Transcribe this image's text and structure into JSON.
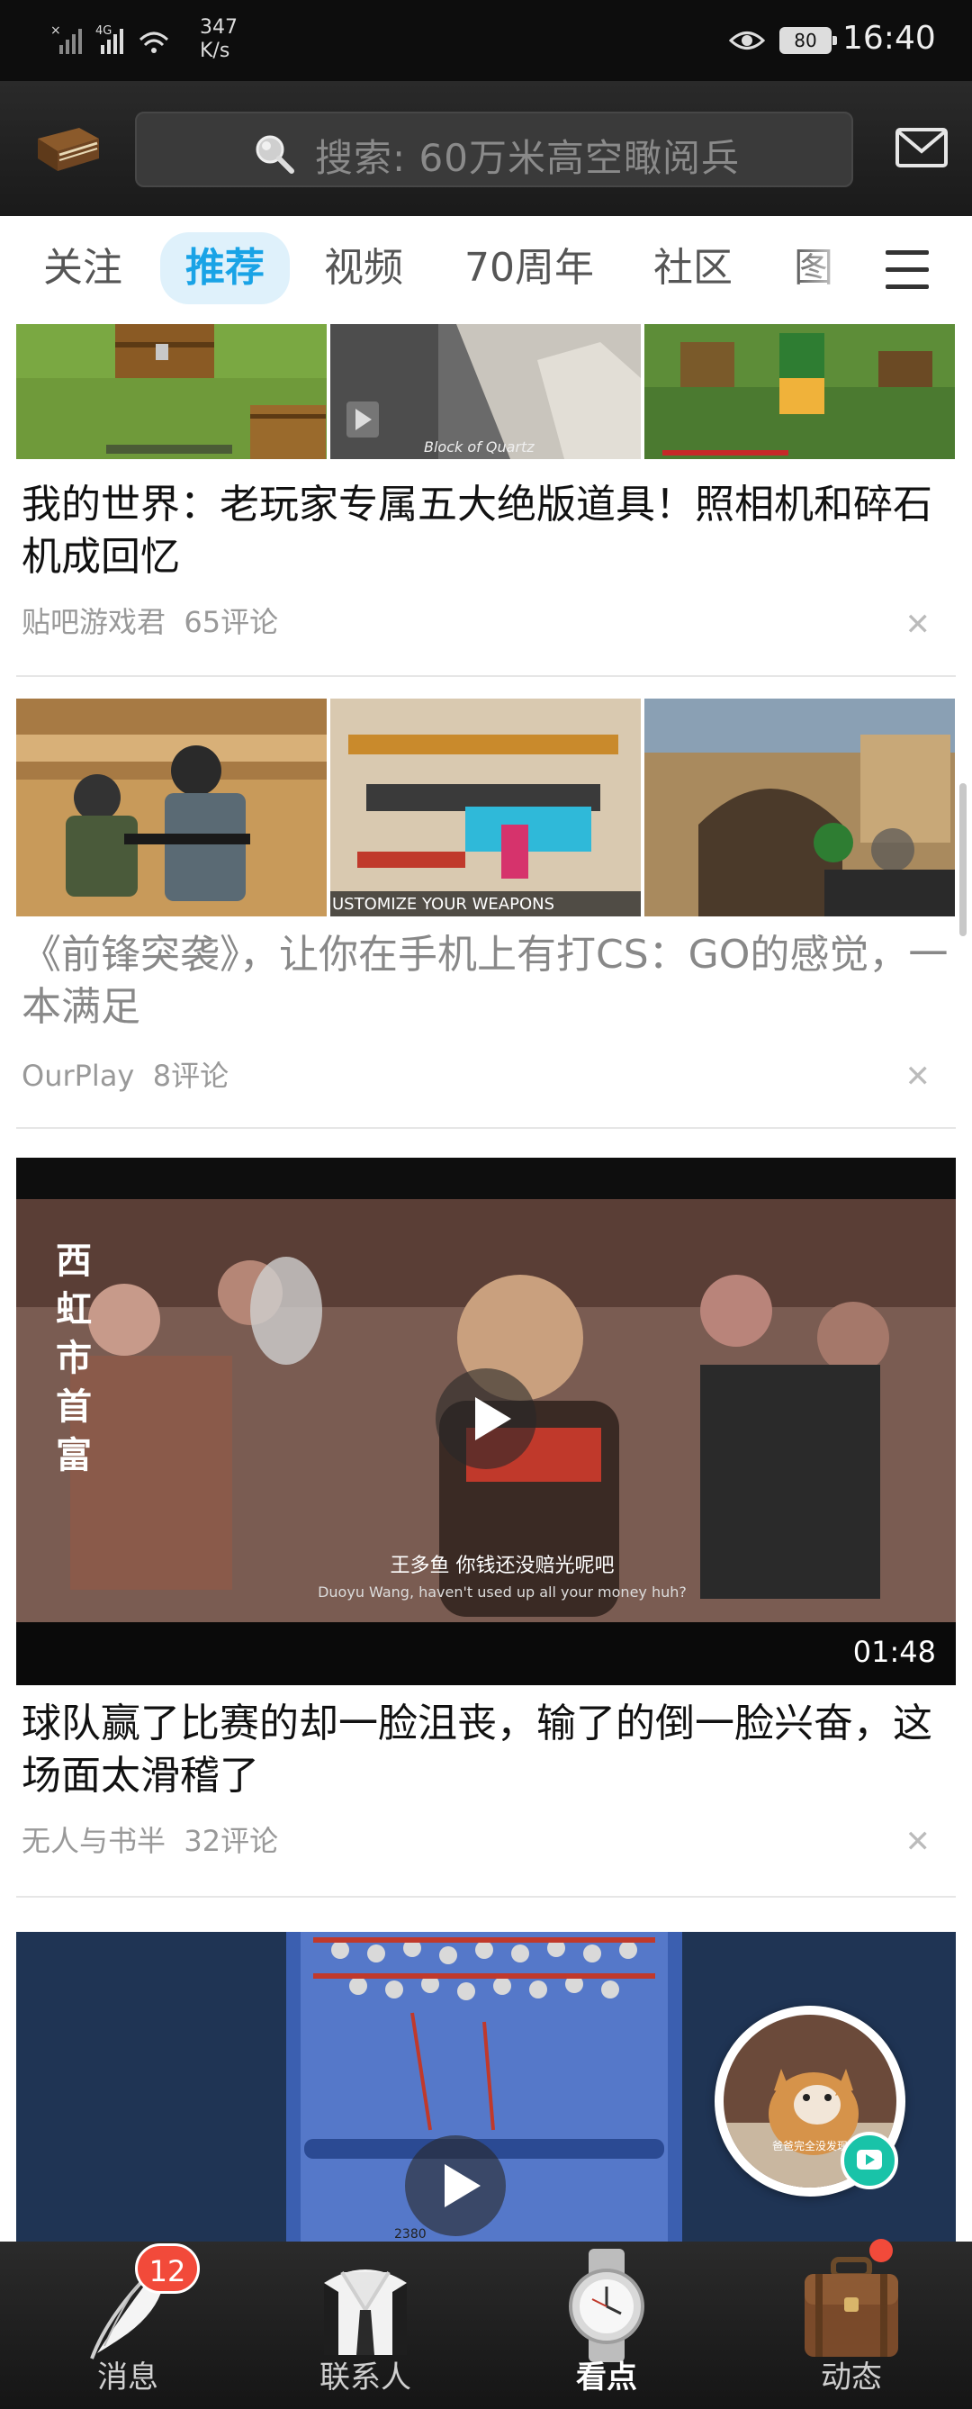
{
  "status_bar": {
    "network_speed_value": "347",
    "network_speed_unit": "K/s",
    "network_type": "4G",
    "battery": "80",
    "time": "16:40"
  },
  "top_bar": {
    "search_placeholder": "搜索: 60万米高空瞰阅兵"
  },
  "tabs": [
    {
      "label": "关注",
      "active": false
    },
    {
      "label": "推荐",
      "active": true
    },
    {
      "label": "视频",
      "active": false
    },
    {
      "label": "70周年",
      "active": false
    },
    {
      "label": "社区",
      "active": false
    },
    {
      "label": "图",
      "active": false
    }
  ],
  "feed": {
    "articles": [
      {
        "title": "我的世界：老玩家专属五大绝版道具！照相机和碎石机成回忆",
        "source": "贴吧游戏君",
        "comments": "65评论",
        "read": false,
        "thumb_caption": "Block of Quartz"
      },
      {
        "title": "《前锋突袭》，让你在手机上有打CS：GO的感觉，一本满足",
        "source": "OurPlay",
        "comments": "8评论",
        "read": true,
        "thumb_caption": "USTOMIZE YOUR WEAPONS"
      },
      {
        "title": "球队赢了比赛的却一脸沮丧，输了的倒一脸兴奋，这场面太滑稽了",
        "source": "无人与书半",
        "comments": "32评论",
        "read": false,
        "duration": "01:48",
        "video_vertical_text": "西虹市首富",
        "video_subtitle_cn": "王多鱼  你钱还没赔光呢吧",
        "video_subtitle_en": "Duoyu Wang, haven't used up all your money huh?"
      },
      {
        "video_label": "2380"
      }
    ]
  },
  "floating_video": {
    "caption": "爸爸完全没发现"
  },
  "bottom_nav": [
    {
      "label": "消息",
      "badge": "12",
      "active": false
    },
    {
      "label": "联系人",
      "active": false
    },
    {
      "label": "看点",
      "active": true
    },
    {
      "label": "动态",
      "dot": true,
      "active": false
    }
  ],
  "colors": {
    "accent": "#19a3e6",
    "badge": "#f24a3a",
    "status_bar": "#0d0d0d",
    "top_bar": "#222222"
  }
}
